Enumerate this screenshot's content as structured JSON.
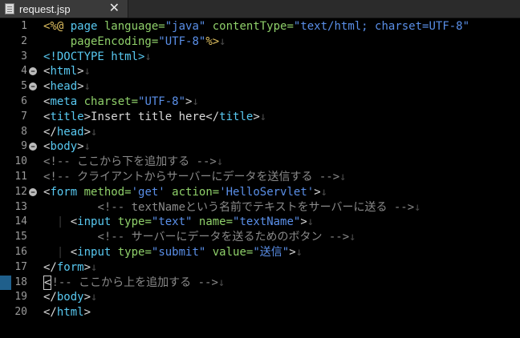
{
  "tab": {
    "title": "request.jsp",
    "close_glyph": "✕"
  },
  "colors": {
    "background": "#000000",
    "default": "#d8d8d8",
    "directive": "#e0c060",
    "tag": "#58c8f0",
    "attribute": "#8fd06a",
    "string": "#5a8fe8",
    "comment": "#8a8a8a",
    "doctype": "#58c8f0",
    "newline": "#4a4a4a",
    "linenumber": "#9a9a9a"
  },
  "lines": [
    {
      "n": "1",
      "fold": false,
      "parts": [
        {
          "t": "<%@ ",
          "c": "directive"
        },
        {
          "t": "page",
          "c": "tag"
        },
        {
          "t": " language=",
          "c": "attribute"
        },
        {
          "t": "\"java\"",
          "c": "string"
        },
        {
          "t": " contentType=",
          "c": "attribute"
        },
        {
          "t": "\"text/html; charset=UTF-8\"",
          "c": "string"
        }
      ]
    },
    {
      "n": "2",
      "fold": false,
      "parts": [
        {
          "t": "    pageEncoding=",
          "c": "attribute"
        },
        {
          "t": "\"UTF-8\"",
          "c": "string"
        },
        {
          "t": "%>",
          "c": "directive"
        },
        {
          "t": "↓",
          "c": "newline"
        }
      ]
    },
    {
      "n": "3",
      "fold": false,
      "parts": [
        {
          "t": "<!DOCTYPE ",
          "c": "doctype"
        },
        {
          "t": "html",
          "c": "tag"
        },
        {
          "t": ">",
          "c": "doctype"
        },
        {
          "t": "↓",
          "c": "newline"
        }
      ]
    },
    {
      "n": "4",
      "fold": true,
      "parts": [
        {
          "t": "<",
          "c": "default"
        },
        {
          "t": "html",
          "c": "tag"
        },
        {
          "t": ">",
          "c": "default"
        },
        {
          "t": "↓",
          "c": "newline"
        }
      ]
    },
    {
      "n": "5",
      "fold": true,
      "parts": [
        {
          "t": "<",
          "c": "default"
        },
        {
          "t": "head",
          "c": "tag"
        },
        {
          "t": ">",
          "c": "default"
        },
        {
          "t": "↓",
          "c": "newline"
        }
      ]
    },
    {
      "n": "6",
      "fold": false,
      "parts": [
        {
          "t": "<",
          "c": "default"
        },
        {
          "t": "meta",
          "c": "tag"
        },
        {
          "t": " charset=",
          "c": "attribute"
        },
        {
          "t": "\"UTF-8\"",
          "c": "string"
        },
        {
          "t": ">",
          "c": "default"
        },
        {
          "t": "↓",
          "c": "newline"
        }
      ]
    },
    {
      "n": "7",
      "fold": false,
      "parts": [
        {
          "t": "<",
          "c": "default"
        },
        {
          "t": "title",
          "c": "tag"
        },
        {
          "t": ">Insert title here</",
          "c": "default"
        },
        {
          "t": "title",
          "c": "tag"
        },
        {
          "t": ">",
          "c": "default"
        },
        {
          "t": "↓",
          "c": "newline"
        }
      ]
    },
    {
      "n": "8",
      "fold": false,
      "parts": [
        {
          "t": "</",
          "c": "default"
        },
        {
          "t": "head",
          "c": "tag"
        },
        {
          "t": ">",
          "c": "default"
        },
        {
          "t": "↓",
          "c": "newline"
        }
      ]
    },
    {
      "n": "9",
      "fold": true,
      "parts": [
        {
          "t": "<",
          "c": "default"
        },
        {
          "t": "body",
          "c": "tag"
        },
        {
          "t": ">",
          "c": "default"
        },
        {
          "t": "↓",
          "c": "newline"
        }
      ]
    },
    {
      "n": "10",
      "fold": false,
      "parts": [
        {
          "t": "<!-- ここから下を追加する -->",
          "c": "comment"
        },
        {
          "t": "↓",
          "c": "newline"
        }
      ]
    },
    {
      "n": "11",
      "fold": false,
      "parts": [
        {
          "t": "<!-- クライアントからサーバーにデータを送信する -->",
          "c": "comment"
        },
        {
          "t": "↓",
          "c": "newline"
        }
      ]
    },
    {
      "n": "12",
      "fold": true,
      "parts": [
        {
          "t": "<",
          "c": "default"
        },
        {
          "t": "form",
          "c": "tag"
        },
        {
          "t": " method=",
          "c": "attribute"
        },
        {
          "t": "'get'",
          "c": "string"
        },
        {
          "t": " action=",
          "c": "attribute"
        },
        {
          "t": "'HelloServlet'",
          "c": "string"
        },
        {
          "t": ">",
          "c": "default"
        },
        {
          "t": "↓",
          "c": "newline"
        }
      ]
    },
    {
      "n": "13",
      "fold": false,
      "parts": [
        {
          "t": "        ",
          "c": "default"
        },
        {
          "t": "<!-- textNameという名前でテキストをサーバーに送る -->",
          "c": "comment"
        },
        {
          "t": "↓",
          "c": "newline"
        }
      ]
    },
    {
      "n": "14",
      "fold": false,
      "parts": [
        {
          "t": "  ",
          "c": "default"
        },
        {
          "t": "|",
          "c": "guide"
        },
        {
          "t": " <",
          "c": "default"
        },
        {
          "t": "input",
          "c": "tag"
        },
        {
          "t": " type=",
          "c": "attribute"
        },
        {
          "t": "\"text\"",
          "c": "string"
        },
        {
          "t": " name=",
          "c": "attribute"
        },
        {
          "t": "\"textName\"",
          "c": "string"
        },
        {
          "t": ">",
          "c": "default"
        },
        {
          "t": "↓",
          "c": "newline"
        }
      ]
    },
    {
      "n": "15",
      "fold": false,
      "parts": [
        {
          "t": "        ",
          "c": "default"
        },
        {
          "t": "<!-- サーバーにデータを送るためのボタン -->",
          "c": "comment"
        },
        {
          "t": "↓",
          "c": "newline"
        }
      ]
    },
    {
      "n": "16",
      "fold": false,
      "parts": [
        {
          "t": "  ",
          "c": "default"
        },
        {
          "t": "|",
          "c": "guide"
        },
        {
          "t": " <",
          "c": "default"
        },
        {
          "t": "input",
          "c": "tag"
        },
        {
          "t": " type=",
          "c": "attribute"
        },
        {
          "t": "\"submit\"",
          "c": "string"
        },
        {
          "t": " value=",
          "c": "attribute"
        },
        {
          "t": "\"送信\"",
          "c": "string"
        },
        {
          "t": ">",
          "c": "default"
        },
        {
          "t": "↓",
          "c": "newline"
        }
      ]
    },
    {
      "n": "17",
      "fold": false,
      "parts": [
        {
          "t": "</",
          "c": "default"
        },
        {
          "t": "form",
          "c": "tag"
        },
        {
          "t": ">",
          "c": "default"
        },
        {
          "t": "↓",
          "c": "newline"
        }
      ]
    },
    {
      "n": "18",
      "fold": false,
      "current": true,
      "parts": [
        {
          "t": "<",
          "c": "cursor"
        },
        {
          "t": "!-- ここから上を追加する -->",
          "c": "comment"
        },
        {
          "t": "↓",
          "c": "newline"
        }
      ]
    },
    {
      "n": "19",
      "fold": false,
      "parts": [
        {
          "t": "</",
          "c": "default"
        },
        {
          "t": "body",
          "c": "tag"
        },
        {
          "t": ">",
          "c": "default"
        },
        {
          "t": "↓",
          "c": "newline"
        }
      ]
    },
    {
      "n": "20",
      "fold": false,
      "parts": [
        {
          "t": "</",
          "c": "default"
        },
        {
          "t": "html",
          "c": "tag"
        },
        {
          "t": ">",
          "c": "default"
        }
      ]
    }
  ]
}
